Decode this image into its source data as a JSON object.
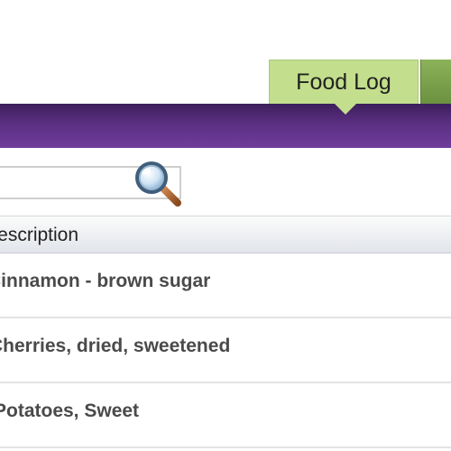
{
  "nav": {
    "active_tab_label": "Food Log"
  },
  "search": {
    "value": "",
    "icon": "magnifying-glass-icon"
  },
  "table": {
    "header_description": "Description",
    "rows": [
      {
        "description": "Cinnamon - brown sugar"
      },
      {
        "description": "Cherries, dried, sweetened"
      },
      {
        "description": "Potatoes, Sweet"
      }
    ]
  },
  "colors": {
    "active_tab": "#c3de8c",
    "next_tab": "#7ba24d",
    "header_bar": "#5a2f82"
  }
}
